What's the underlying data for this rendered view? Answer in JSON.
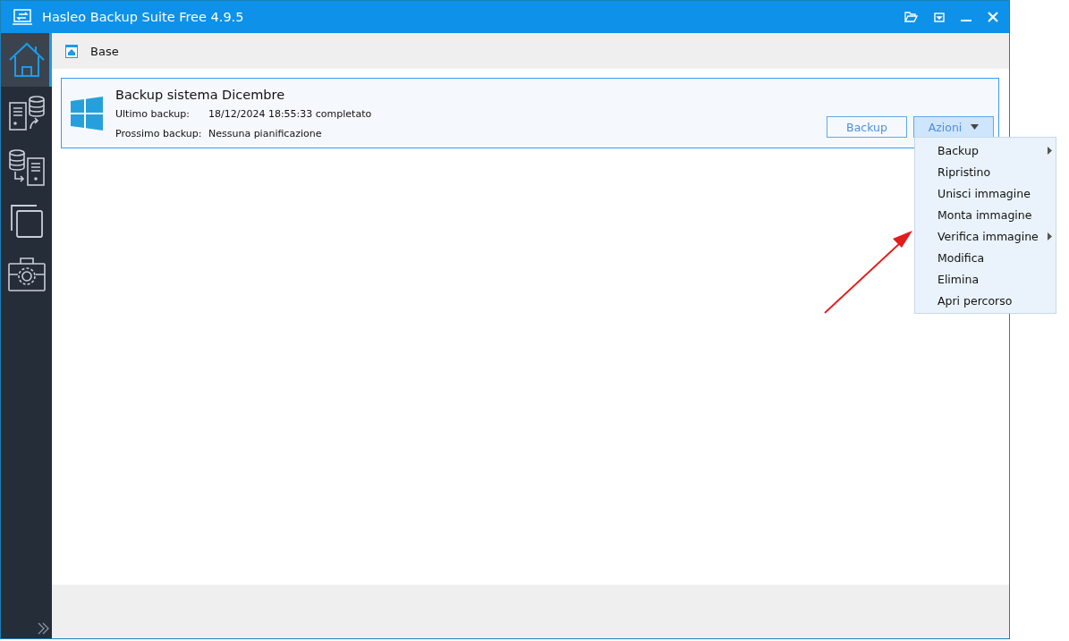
{
  "window": {
    "title": "Hasleo Backup Suite Free 4.9.5"
  },
  "sidebar": {
    "items": [
      {
        "selected": true
      },
      {
        "selected": false
      },
      {
        "selected": false
      },
      {
        "selected": false
      },
      {
        "selected": false
      }
    ]
  },
  "breadcrumb": "Base",
  "task": {
    "name": "Backup sistema Dicembre",
    "fields": [
      {
        "label": "Ultimo backup:",
        "value": "18/12/2024 18:55:33 completato"
      },
      {
        "label": "Prossimo backup:",
        "value": "Nessuna pianificazione"
      }
    ],
    "backup_button": "Backup",
    "actions_button": "Azioni",
    "actions_open": true
  },
  "menu": {
    "items": [
      {
        "label": "Backup",
        "submenu": true
      },
      {
        "label": "Ripristino",
        "submenu": false
      },
      {
        "label": "Unisci immagine",
        "submenu": false
      },
      {
        "label": "Monta immagine",
        "submenu": false
      },
      {
        "label": "Verifica immagine",
        "submenu": true
      },
      {
        "label": "Modifica",
        "submenu": false
      },
      {
        "label": "Elimina",
        "submenu": false
      },
      {
        "label": "Apri percorso",
        "submenu": false
      }
    ]
  }
}
